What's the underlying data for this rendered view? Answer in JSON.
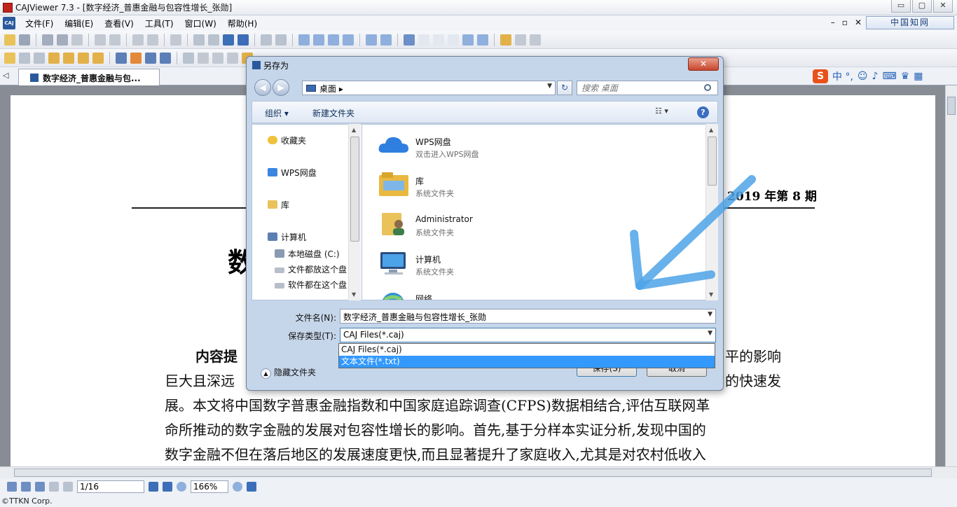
{
  "window": {
    "title": "CAJViewer 7.3 - [数字经济_普惠金融与包容性增长_张勋]",
    "logo_text": "CAJ",
    "controls": {
      "minimize": "▭",
      "restore": "▢",
      "close": "✕"
    },
    "mdi_controls": [
      "–",
      "▫",
      "✕"
    ],
    "cnki_button": "中国知网"
  },
  "menu": {
    "items": [
      "文件(F)",
      "编辑(E)",
      "查看(V)",
      "工具(T)",
      "窗口(W)",
      "帮助(H)"
    ]
  },
  "tabs": {
    "scroll_arrow": "◁",
    "active": "数字经济_普惠金融与包...",
    "ime_text": "中 °,"
  },
  "document": {
    "issue": "2019 年第 8 期",
    "heading_fragment": "数",
    "lines": [
      {
        "lead": "内容提",
        "tail": "平的影响"
      },
      {
        "text": "巨大且深远",
        "tail": "的快速发"
      },
      {
        "text": "展。本文将中国数字普惠金融指数和中国家庭追踪调查(CFPS)数据相结合,评估互联网革"
      },
      {
        "text": "命所推动的数字金融的发展对包容性增长的影响。首先,基于分样本实证分析,发现中国的"
      },
      {
        "text": "数字金融不但在落后地区的发展速度更快,而且显著提升了家庭收入,尤其是对农村低收入"
      }
    ]
  },
  "statusbar": {
    "page": "1/16",
    "zoom": "166%"
  },
  "copyright": "©TTKN Corp.",
  "dialog": {
    "title": "另存为",
    "close": "✕",
    "nav": {
      "back": "◀",
      "forward": "▶",
      "address": "桌面",
      "address_sep": "▸",
      "refresh": "↻",
      "search_placeholder": "搜索 桌面"
    },
    "commands": {
      "organize": "组织 ▾",
      "new_folder": "新建文件夹",
      "view": "☷ ▾",
      "help": "?"
    },
    "nav_pane": {
      "favorites": "收藏夹",
      "wps": "WPS网盘",
      "library": "库",
      "computer": "计算机",
      "drive_c": "本地磁盘 (C:)",
      "drive_d": "文件都放这个盘",
      "drive_e": "软件都在这个盘"
    },
    "files": [
      {
        "name": "WPS网盘",
        "sub": "双击进入WPS网盘"
      },
      {
        "name": "库",
        "sub": "系统文件夹"
      },
      {
        "name": "Administrator",
        "sub": "系统文件夹"
      },
      {
        "name": "计算机",
        "sub": "系统文件夹"
      },
      {
        "name": "网络",
        "sub": ""
      }
    ],
    "form": {
      "filename_label": "文件名(N):",
      "filename_value": "数字经济_普惠金融与包容性增长_张勋",
      "type_label": "保存类型(T):",
      "type_value": "CAJ Files(*.caj)",
      "dropdown_options": [
        "CAJ Files(*.caj)",
        "文本文件(*.txt)"
      ],
      "selected_index": 1,
      "hide_folders": "隐藏文件夹",
      "save": "保存(S)",
      "cancel": "取消"
    }
  },
  "colors": {
    "accent": "#3399ff",
    "annotation_arrow": "#4da3e8"
  }
}
